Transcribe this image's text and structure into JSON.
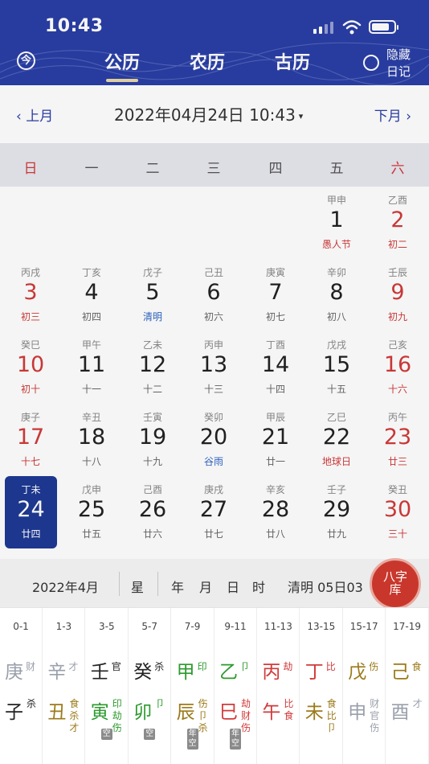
{
  "status": {
    "time": "10:43"
  },
  "nav": {
    "left_icon": "今",
    "tabs": [
      "公历",
      "农历",
      "古历"
    ],
    "active_tab": 0,
    "right_label": "隐藏日记"
  },
  "picker": {
    "prev": "上月",
    "next": "下月",
    "date_text": "2022年04月24日 10:43",
    "caret": "▾"
  },
  "weekdays": [
    "日",
    "一",
    "二",
    "三",
    "四",
    "五",
    "六"
  ],
  "calendar": [
    [
      null,
      null,
      null,
      null,
      null,
      {
        "gz": "甲申",
        "d": "1",
        "lu": "愚人节",
        "kind": "fest"
      },
      {
        "gz": "乙酉",
        "d": "2",
        "lu": "初二",
        "red": true
      }
    ],
    [
      {
        "gz": "丙戌",
        "d": "3",
        "lu": "初三",
        "red": true
      },
      {
        "gz": "丁亥",
        "d": "4",
        "lu": "初四"
      },
      {
        "gz": "戊子",
        "d": "5",
        "lu": "清明",
        "kind": "term"
      },
      {
        "gz": "己丑",
        "d": "6",
        "lu": "初六"
      },
      {
        "gz": "庚寅",
        "d": "7",
        "lu": "初七"
      },
      {
        "gz": "辛卯",
        "d": "8",
        "lu": "初八"
      },
      {
        "gz": "壬辰",
        "d": "9",
        "lu": "初九",
        "red": true
      }
    ],
    [
      {
        "gz": "癸巳",
        "d": "10",
        "lu": "初十",
        "red": true
      },
      {
        "gz": "甲午",
        "d": "11",
        "lu": "十一"
      },
      {
        "gz": "乙未",
        "d": "12",
        "lu": "十二"
      },
      {
        "gz": "丙申",
        "d": "13",
        "lu": "十三"
      },
      {
        "gz": "丁酉",
        "d": "14",
        "lu": "十四"
      },
      {
        "gz": "戊戌",
        "d": "15",
        "lu": "十五"
      },
      {
        "gz": "己亥",
        "d": "16",
        "lu": "十六",
        "red": true
      }
    ],
    [
      {
        "gz": "庚子",
        "d": "17",
        "lu": "十七",
        "red": true
      },
      {
        "gz": "辛丑",
        "d": "18",
        "lu": "十八"
      },
      {
        "gz": "壬寅",
        "d": "19",
        "lu": "十九"
      },
      {
        "gz": "癸卯",
        "d": "20",
        "lu": "谷雨",
        "kind": "term"
      },
      {
        "gz": "甲辰",
        "d": "21",
        "lu": "廿一"
      },
      {
        "gz": "乙巳",
        "d": "22",
        "lu": "地球日",
        "kind": "fest"
      },
      {
        "gz": "丙午",
        "d": "23",
        "lu": "廿三",
        "red": true
      }
    ],
    [
      {
        "gz": "丁未",
        "d": "24",
        "lu": "廿四",
        "sel": true
      },
      {
        "gz": "戊申",
        "d": "25",
        "lu": "廿五"
      },
      {
        "gz": "己酉",
        "d": "26",
        "lu": "廿六"
      },
      {
        "gz": "庚戌",
        "d": "27",
        "lu": "廿七"
      },
      {
        "gz": "辛亥",
        "d": "28",
        "lu": "廿八"
      },
      {
        "gz": "壬子",
        "d": "29",
        "lu": "廿九"
      },
      {
        "gz": "癸丑",
        "d": "30",
        "lu": "三十",
        "red": true
      }
    ]
  ],
  "summary": {
    "month": "2022年4月",
    "xing": "星",
    "nian": "年",
    "yue": "月",
    "ri": "日",
    "shi": "时",
    "term": "清明 05日03"
  },
  "bazi_button": {
    "line1": "八字",
    "line2": "库"
  },
  "hours": [
    {
      "range": "0-1",
      "stem": "庚",
      "stem_god": "财",
      "stem_color": "grey",
      "branch": "子",
      "branch_gods": [
        "杀"
      ],
      "branch_color": "black"
    },
    {
      "range": "1-3",
      "stem": "辛",
      "stem_god": "才",
      "stem_color": "grey",
      "branch": "丑",
      "branch_gods": [
        "食",
        "杀",
        "才"
      ],
      "branch_color": "gold"
    },
    {
      "range": "3-5",
      "stem": "壬",
      "stem_god": "官",
      "stem_color": "black",
      "branch": "寅",
      "branch_gods": [
        "印",
        "劫",
        "伤"
      ],
      "branch_color": "green",
      "kong": "空"
    },
    {
      "range": "5-7",
      "stem": "癸",
      "stem_god": "杀",
      "stem_color": "black",
      "branch": "卯",
      "branch_gods": [
        "卩"
      ],
      "branch_color": "green",
      "kong": "空"
    },
    {
      "range": "7-9",
      "stem": "甲",
      "stem_god": "印",
      "stem_color": "green",
      "branch": "辰",
      "branch_gods": [
        "伤",
        "卩",
        "杀"
      ],
      "branch_color": "gold",
      "kong": "年空"
    },
    {
      "range": "9-11",
      "stem": "乙",
      "stem_god": "卩",
      "stem_color": "green",
      "branch": "巳",
      "branch_gods": [
        "劫",
        "财",
        "伤"
      ],
      "branch_color": "red",
      "kong": "年空"
    },
    {
      "range": "11-13",
      "stem": "丙",
      "stem_god": "劫",
      "stem_color": "red",
      "branch": "午",
      "branch_gods": [
        "比",
        "食"
      ],
      "branch_color": "red"
    },
    {
      "range": "13-15",
      "stem": "丁",
      "stem_god": "比",
      "stem_color": "red",
      "branch": "未",
      "branch_gods": [
        "食",
        "比",
        "卩"
      ],
      "branch_color": "gold"
    },
    {
      "range": "15-17",
      "stem": "戊",
      "stem_god": "伤",
      "stem_color": "gold",
      "branch": "申",
      "branch_gods": [
        "财",
        "官",
        "伤"
      ],
      "branch_color": "grey"
    },
    {
      "range": "17-19",
      "stem": "己",
      "stem_god": "食",
      "stem_color": "gold",
      "branch": "酉",
      "branch_gods": [
        "才"
      ],
      "branch_color": "grey"
    }
  ]
}
